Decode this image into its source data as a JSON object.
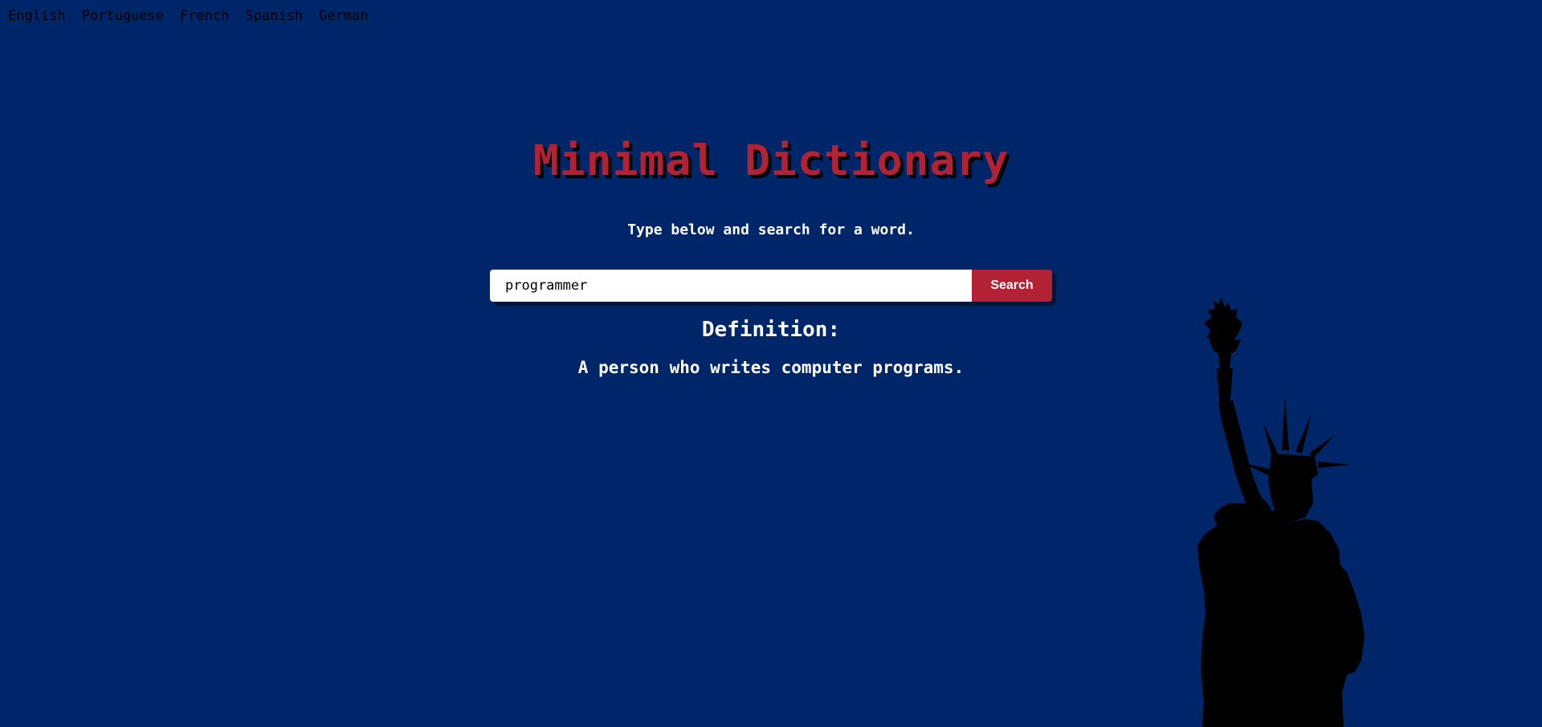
{
  "languages": [
    "English",
    "Portuguese",
    "French",
    "Spanish",
    "German"
  ],
  "header": {
    "title": "Minimal Dictionary",
    "subtitle": "Type below and search for a word."
  },
  "search": {
    "value": "programmer",
    "button_label": "Search"
  },
  "result": {
    "heading": "Definition:",
    "text": "A person who writes computer programs."
  },
  "colors": {
    "background": "#00266a",
    "accent": "#b22234",
    "text": "#ffffff"
  },
  "decoration": {
    "icon": "statue-of-liberty-icon"
  }
}
